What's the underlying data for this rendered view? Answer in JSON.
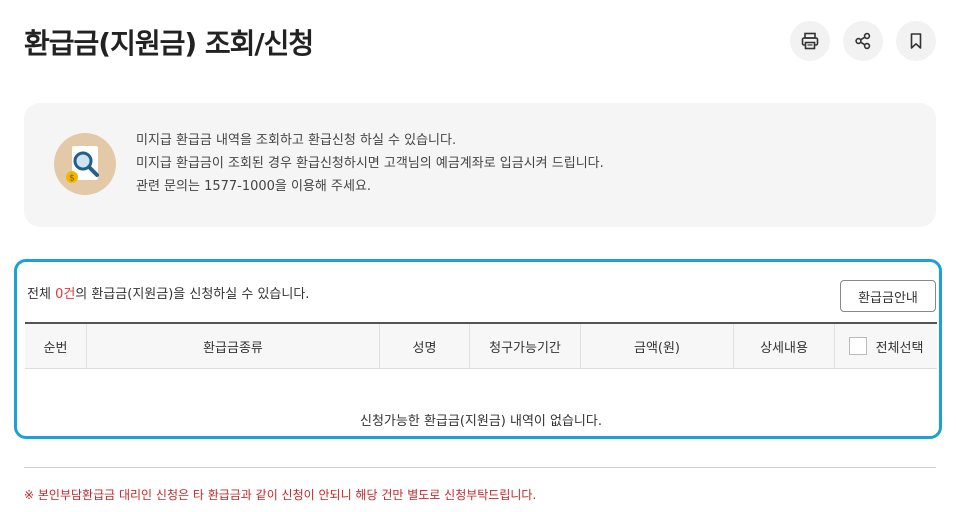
{
  "page": {
    "title": "환급금(지원금) 조회/신청"
  },
  "toolbar": {
    "print_icon": "print-icon",
    "share_icon": "share-icon",
    "bookmark_icon": "bookmark-icon"
  },
  "info": {
    "icon": "magnifier-document-icon",
    "lines": [
      "미지급 환급금 내역을 조회하고 환급신청 하실 수 있습니다.",
      "미지급 환급금이 조회된 경우 환급신청하시면 고객님의 예금계좌로 입금시켜 드립니다.",
      "관련 문의는 1577-1000을 이용해 주세요."
    ]
  },
  "list": {
    "count_prefix": "전체 ",
    "count": "0건",
    "count_suffix": "의 환급금(지원금)을 신청하실 수 있습니다.",
    "guide_button": "환급금안내",
    "columns": [
      "순번",
      "환급금종류",
      "성명",
      "청구가능기간",
      "금액(원)",
      "상세내용",
      "전체선택"
    ],
    "empty_message": "신청가능한 환급금(지원금) 내역이 없습니다."
  },
  "notice": "※ 본인부담환급금 대리인 신청은 타 환급금과 같이 신청이 안되니 해당 건만 별도로 신청부탁드립니다.",
  "colors": {
    "accent": "#1aa1d6",
    "count_red": "#e53935",
    "notice_red": "#c62828"
  }
}
